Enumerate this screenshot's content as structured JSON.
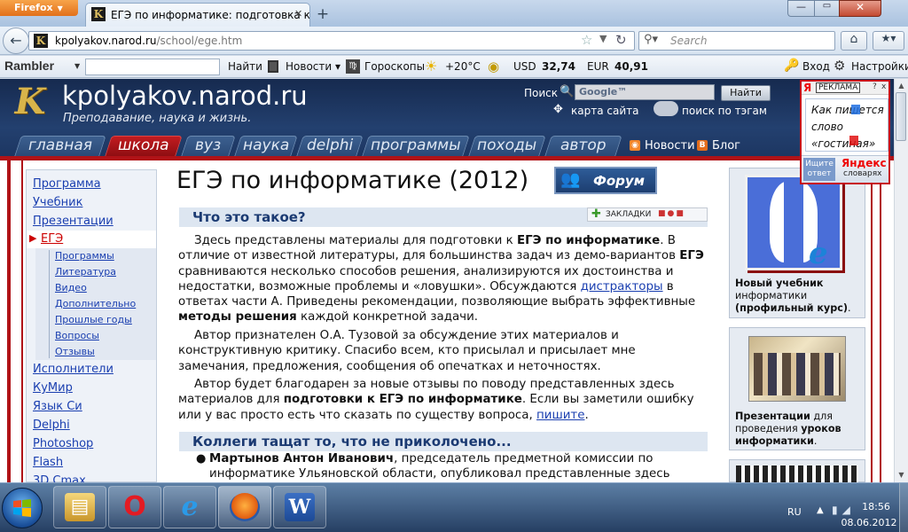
{
  "browser": {
    "firefox_label": "Firefox",
    "tab_title": "ЕГЭ по информатике: подготовка к ЕГЭ...",
    "url_domain": "kpolyakov.narod.ru",
    "url_path": "/school/ege.htm",
    "search_placeholder": "Search"
  },
  "rambler": {
    "logo": "Rambler",
    "find": "Найти",
    "news": "Новости",
    "horoscope": "Гороскопы",
    "temp": "+20°C",
    "usd_label": "USD",
    "usd_value": "32,74",
    "eur_label": "EUR",
    "eur_value": "40,91",
    "login": "Вход",
    "settings": "Настройки"
  },
  "header": {
    "logo_letter": "K",
    "site_title": "kpolyakov.narod.ru",
    "subtitle": "Преподавание, наука и жизнь.",
    "search_label": "Поиск",
    "search_input": "Google™",
    "search_button": "Найти",
    "sitemap": "карта сайта",
    "tag_search": "поиск по тэгам",
    "nav_tabs": [
      "главная",
      "школа",
      "вуз",
      "наука",
      "delphi",
      "программы",
      "походы",
      "автор"
    ],
    "rss_label": "Новости",
    "blog_label": "Блог"
  },
  "sidebar": {
    "top_items": [
      "Программа",
      "Учебник",
      "Презентации"
    ],
    "active_item": "ЕГЭ",
    "sub_items": [
      "Программы",
      "Литература",
      "Видео",
      "Дополнительно",
      "Прошлые годы",
      "Вопросы",
      "Отзывы"
    ],
    "bottom_items": [
      "Исполнители",
      "КуМир",
      "Язык Си",
      "Delphi",
      "Photoshop",
      "Flash",
      "3D Cmax"
    ]
  },
  "main": {
    "title": "ЕГЭ по информатике (2012)",
    "forum_button": "Форум",
    "bookmarks_label": "ЗАКЛАДКИ",
    "section1": "Что это такое?",
    "p1": {
      "a": "Здесь представлены материалы для подготовки к ",
      "b1": "ЕГЭ по информатике",
      "c": ". В отличие от известной литературы, для большинства задач из демо-вариантов ",
      "b2": "ЕГЭ",
      "d": " сравниваются несколько способов решения, анализируются их достоинства и недостатки, возможные проблемы и «ловушки». Обсуждаются ",
      "link": "дистракторы",
      "e": " в ответах части А. Приведены рекомендации, позволяющие выбрать эффективные ",
      "b3": "методы решения",
      "f": " каждой конкретной задачи."
    },
    "p2": "Автор признателен О.А. Тузовой за обсуждение этих материалов и конструктивную критику. Спасибо всем, кто присылал и присылает мне замечания, предложения, сообщения об опечатках и неточностях.",
    "p3": {
      "a": "Автор будет благодарен за новые отзывы по поводу представленных здесь материалов для ",
      "b": "подготовки к ЕГЭ по информатике",
      "c": ". Если вы заметили ошибку или у вас просто есть что сказать по существу вопроса, ",
      "link": "пишите",
      "d": "."
    },
    "section2": "Коллеги тащат то, что не приколочено...",
    "bullet_name": "Мартынов Антон Иванович",
    "bullet_text": ", председатель предметной комиссии по информатике Ульяновской области, опубликовал представленные здесь"
  },
  "right": {
    "box1_cap_a": "Новый учебник",
    "box1_cap_b": "информатики",
    "box1_cap_c": "(профильный курс)",
    "box1_cap_d": ".",
    "box2_cap_a": "Презентации",
    "box2_cap_b": " для проведения ",
    "box2_cap_c": "уроков информатики",
    "box2_cap_d": "."
  },
  "yandex": {
    "ya": "Я",
    "ad_label": "РЕКЛАМА",
    "q": "?",
    "x": "x",
    "line1": "Как пишется",
    "line2": "слово",
    "line3": "«гостиная»",
    "search_btn": "Ищите ответ",
    "brand": "Яндекс",
    "brand_sub": "словарях"
  },
  "taskbar": {
    "lang": "RU",
    "time": "18:56",
    "date": "08.06.2012"
  },
  "colors": {
    "header_bg": "#1c3560",
    "accent_red": "#b01217",
    "link": "#1a3fb0",
    "section_head": "#1b3a72"
  }
}
